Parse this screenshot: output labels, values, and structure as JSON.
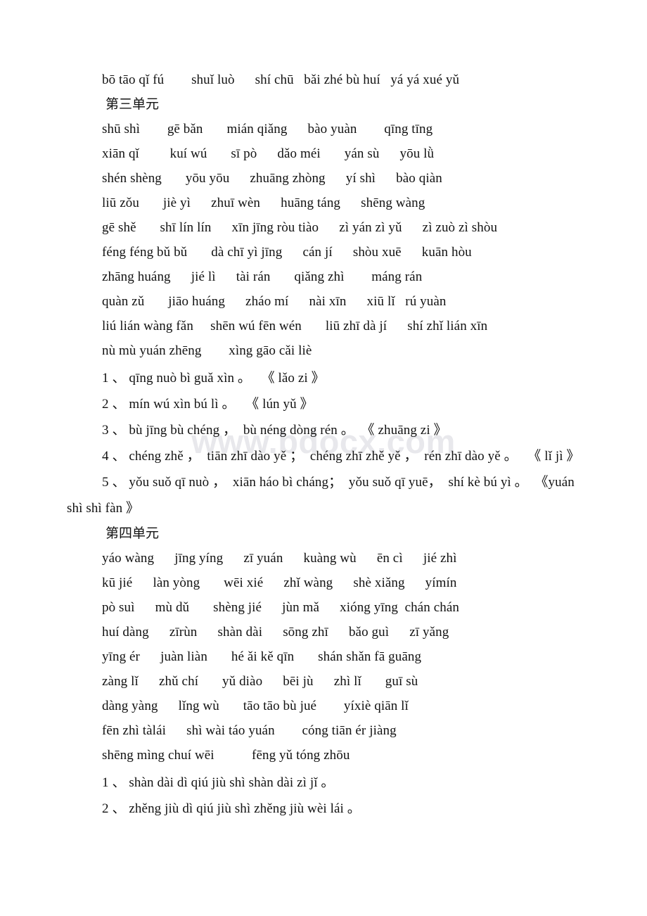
{
  "document": {
    "watermark": "www.bdocx.com",
    "blocks": [
      {
        "type": "line",
        "text": "bō tāo qǐ fú        shuǐ luò      shí chū   bǎi zhé bù huí   yá yá xué yǔ"
      },
      {
        "type": "heading",
        "text": "第三单元"
      },
      {
        "type": "line",
        "text": "shū shì        gē bǎn       mián qiǎng      bào yuàn        qīng tīng"
      },
      {
        "type": "line",
        "text": "xiān qǐ         kuí wú       sī pò      dǎo méi       yán sù      yōu lǜ"
      },
      {
        "type": "line",
        "text": "shén shèng       yōu yōu      zhuāng zhòng      yí shì      bào qiàn"
      },
      {
        "type": "line",
        "text": "liū zǒu       jiè yì      zhuī wèn      huāng táng      shēng wàng"
      },
      {
        "type": "line",
        "text": "gē shě       shī lín lín      xīn jīng ròu tiào      zì yán zì yǔ      zì zuò zì shòu"
      },
      {
        "type": "line",
        "text": "féng féng bǔ bǔ       dà chī yì jīng      cán jí      shòu xuē      kuān hòu"
      },
      {
        "type": "line",
        "text": "zhāng huáng      jié lì      tài rán       qiǎng zhì        máng rán"
      },
      {
        "type": "line",
        "text": "quàn zǔ       jiāo huáng      zháo mí      nài xīn      xiū lǐ   rú yuàn"
      },
      {
        "type": "line",
        "text": "liú lián wàng fǎn     shēn wú fēn wén       liū zhī dà jí      shí zhǐ lián xīn"
      },
      {
        "type": "line",
        "text": "nù mù yuán zhēng        xìng gāo cǎi liè"
      },
      {
        "type": "sentence",
        "text": "1 、 qīng nuò bì guǎ xìn 。   《 lǎo zi 》"
      },
      {
        "type": "sentence",
        "text": "2 、 mín wú xìn bú lì 。   《 lún yǔ 》"
      },
      {
        "type": "sentence",
        "text": "3 、 bù jīng bù chéng ，  bù néng dòng rén 。  《 zhuāng zi 》"
      },
      {
        "type": "sentence",
        "text": "4 、 chéng zhě ，  tiān zhī dào yě ；  chéng zhī zhě yě ，  rén zhī dào yě 。   《 lǐ jì 》"
      },
      {
        "type": "sentence-hang",
        "text": "5 、 yǒu suǒ qī nuò ，  xiān háo bì cháng；  yǒu suǒ qī yuē，  shí kè bú yì 。  《yuán shì shì fàn 》"
      },
      {
        "type": "heading",
        "text": "第四单元"
      },
      {
        "type": "line",
        "text": "yáo wàng      jīng yíng      zī yuán      kuàng wù      ēn cì      jié zhì"
      },
      {
        "type": "line",
        "text": "kū jié      làn yòng       wēi xié      zhǐ wàng      shè xiǎng      yímín"
      },
      {
        "type": "line",
        "text": "pò suì      mù dǔ       shèng jié      jùn mǎ      xióng yīng  chán chán"
      },
      {
        "type": "line",
        "text": "huí dàng      zīrùn      shàn dài      sōng zhī      bǎo guì      zī yǎng"
      },
      {
        "type": "line",
        "text": "yīng ér      juàn liàn       hé ǎi kě qīn       shán shǎn fā guāng"
      },
      {
        "type": "line",
        "text": "zàng lǐ      zhǔ chí       yǔ diào      bēi jù      zhì lǐ       guī sù"
      },
      {
        "type": "line",
        "text": "dàng yàng      lǐng wù       tāo tāo bù jué        yíxiè qiān lǐ"
      },
      {
        "type": "line",
        "text": "fēn zhì tàlái      shì wài táo yuán        cóng tiān ér jiàng"
      },
      {
        "type": "line",
        "text": "shēng mìng chuí wēi           fēng yǔ tóng zhōu"
      },
      {
        "type": "sentence",
        "text": "1 、 shàn dài dì qiú jiù shì shàn dài zì jǐ 。"
      },
      {
        "type": "sentence",
        "text": "2 、 zhěng jiù dì qiú jiù shì zhěng jiù wèi lái 。"
      }
    ]
  }
}
